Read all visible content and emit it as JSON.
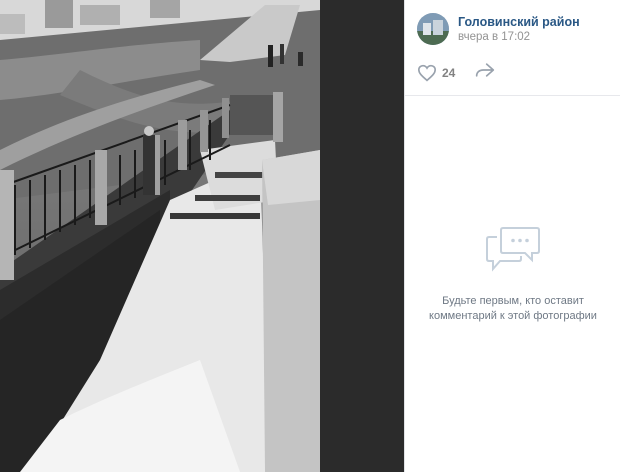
{
  "post": {
    "author_name": "Головинский район",
    "time": "вчера в 17:02",
    "avatar_icon": "avatar-image"
  },
  "actions": {
    "like_icon": "heart-icon",
    "like_count": "24",
    "share_icon": "share-arrow-icon"
  },
  "comments": {
    "empty_icon": "comments-bubble-icon",
    "empty_text": "Будьте первым, кто оставит комментарий к этой фотографии"
  },
  "photo": {
    "description_icon": "black-and-white-photo-canal-spillway"
  },
  "colors": {
    "link": "#2a5885",
    "muted": "#939393",
    "icon": "#99a2ad"
  }
}
